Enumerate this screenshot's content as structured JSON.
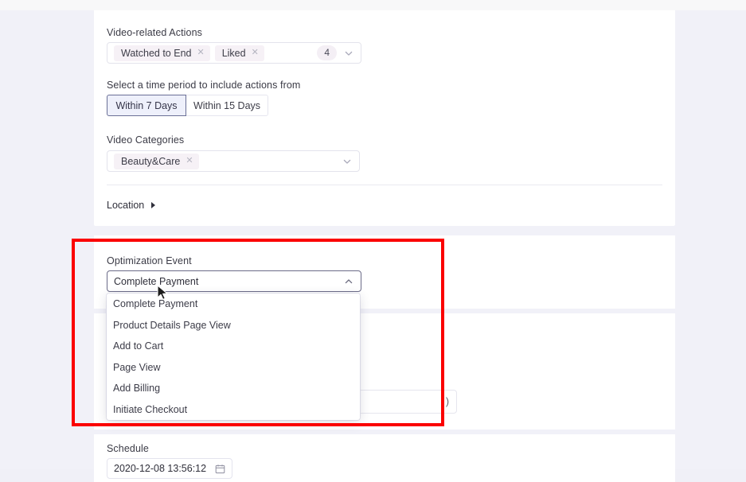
{
  "audience_card": {
    "video_actions": {
      "label": "Video-related Actions",
      "chips": [
        {
          "text": "Watched to End",
          "remove": "✕"
        },
        {
          "text": "Liked",
          "remove": "✕"
        }
      ],
      "count": "4"
    },
    "time_period": {
      "label": "Select a time period to include actions from",
      "options": [
        {
          "label": "Within 7 Days",
          "selected": true
        },
        {
          "label": "Within 15 Days",
          "selected": false
        }
      ]
    },
    "video_categories": {
      "label": "Video Categories",
      "chips": [
        {
          "text": "Beauty&Care",
          "remove": "✕"
        }
      ]
    },
    "location": {
      "label": "Location"
    }
  },
  "optimization_card": {
    "label": "Optimization Event",
    "selected_value": "Complete Payment",
    "expanded": true,
    "options": [
      "Complete Payment",
      "Product Details Page View",
      "Add to Cart",
      "Page View",
      "Add Billing",
      "Initiate Checkout"
    ]
  },
  "bidding_card": {
    "partial_value": ")"
  },
  "schedule_card": {
    "label": "Schedule",
    "datetime_value": "2020-12-08 13:56:12"
  },
  "icons": {
    "chevron_down": "chevron-down-icon",
    "chevron_up": "chevron-up-icon",
    "calendar": "calendar-icon",
    "caret_right": "caret-right-icon",
    "cursor": "mouse-cursor"
  },
  "colors": {
    "page_background": "#f1f1f8",
    "card_background": "#ffffff",
    "chip_background": "#f6f1f6",
    "active_tab_background": "#eef0fb",
    "active_tab_border": "#6a6f96",
    "annotation_red": "#fb0000",
    "text_primary": "#3b3b46"
  }
}
